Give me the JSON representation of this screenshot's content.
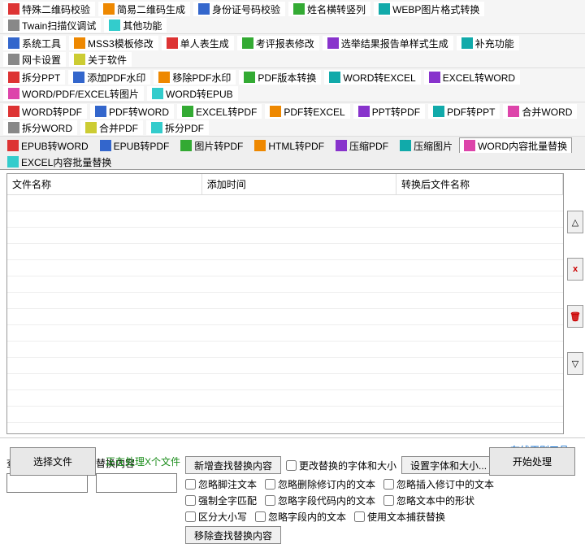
{
  "toolbar_rows": [
    [
      {
        "label": "特殊二维码校验",
        "ic": "ic-red",
        "name": "special-qr-verify"
      },
      {
        "label": "简易二维码生成",
        "ic": "ic-orange",
        "name": "simple-qr-gen"
      },
      {
        "label": "身份证号码校验",
        "ic": "ic-blue",
        "name": "id-verify"
      },
      {
        "label": "姓名横转竖列",
        "ic": "ic-green",
        "name": "name-rotate"
      },
      {
        "label": "WEBP图片格式转换",
        "ic": "ic-teal",
        "name": "webp-convert"
      },
      {
        "label": "Twain扫描仪调试",
        "ic": "ic-gray",
        "name": "twain-scan"
      },
      {
        "label": "其他功能",
        "ic": "ic-cyan",
        "name": "other-tools"
      }
    ],
    [
      {
        "label": "系统工具",
        "ic": "ic-blue",
        "name": "system-tools"
      },
      {
        "label": "MSS3模板修改",
        "ic": "ic-orange",
        "name": "mss3-template"
      },
      {
        "label": "单人表生成",
        "ic": "ic-red",
        "name": "single-form"
      },
      {
        "label": "考评报表修改",
        "ic": "ic-green",
        "name": "eval-report"
      },
      {
        "label": "选举结果报告单样式生成",
        "ic": "ic-purple",
        "name": "election-report"
      },
      {
        "label": "补充功能",
        "ic": "ic-teal",
        "name": "extra-func"
      },
      {
        "label": "网卡设置",
        "ic": "ic-gray",
        "name": "network-card"
      },
      {
        "label": "关于软件",
        "ic": "ic-yellow",
        "name": "about"
      }
    ],
    [
      {
        "label": "拆分PPT",
        "ic": "ic-red",
        "name": "split-ppt"
      },
      {
        "label": "添加PDF水印",
        "ic": "ic-blue",
        "name": "add-watermark"
      },
      {
        "label": "移除PDF水印",
        "ic": "ic-orange",
        "name": "remove-watermark"
      },
      {
        "label": "PDF版本转换",
        "ic": "ic-green",
        "name": "pdf-version"
      },
      {
        "label": "WORD转EXCEL",
        "ic": "ic-teal",
        "name": "word-to-excel"
      },
      {
        "label": "EXCEL转WORD",
        "ic": "ic-purple",
        "name": "excel-to-word"
      },
      {
        "label": "WORD/PDF/EXCEL转图片",
        "ic": "ic-pink",
        "name": "doc-to-image"
      },
      {
        "label": "WORD转EPUB",
        "ic": "ic-cyan",
        "name": "word-to-epub"
      }
    ],
    [
      {
        "label": "WORD转PDF",
        "ic": "ic-red",
        "name": "word-to-pdf"
      },
      {
        "label": "PDF转WORD",
        "ic": "ic-blue",
        "name": "pdf-to-word"
      },
      {
        "label": "EXCEL转PDF",
        "ic": "ic-green",
        "name": "excel-to-pdf"
      },
      {
        "label": "PDF转EXCEL",
        "ic": "ic-orange",
        "name": "pdf-to-excel"
      },
      {
        "label": "PPT转PDF",
        "ic": "ic-purple",
        "name": "ppt-to-pdf"
      },
      {
        "label": "PDF转PPT",
        "ic": "ic-teal",
        "name": "pdf-to-ppt"
      },
      {
        "label": "合并WORD",
        "ic": "ic-pink",
        "name": "merge-word"
      },
      {
        "label": "拆分WORD",
        "ic": "ic-gray",
        "name": "split-word"
      },
      {
        "label": "合并PDF",
        "ic": "ic-yellow",
        "name": "merge-pdf"
      },
      {
        "label": "拆分PDF",
        "ic": "ic-cyan",
        "name": "split-pdf"
      }
    ]
  ],
  "tabs": [
    {
      "label": "EPUB转WORD",
      "ic": "ic-red",
      "active": false
    },
    {
      "label": "EPUB转PDF",
      "ic": "ic-blue",
      "active": false
    },
    {
      "label": "图片转PDF",
      "ic": "ic-green",
      "active": false
    },
    {
      "label": "HTML转PDF",
      "ic": "ic-orange",
      "active": false
    },
    {
      "label": "压缩PDF",
      "ic": "ic-purple",
      "active": false
    },
    {
      "label": "压缩图片",
      "ic": "ic-teal",
      "active": false
    },
    {
      "label": "WORD内容批量替换",
      "ic": "ic-pink",
      "active": true
    },
    {
      "label": "EXCEL内容批量替换",
      "ic": "ic-cyan",
      "active": false
    }
  ],
  "table": {
    "columns": [
      "文件名称",
      "添加时间",
      "转换后文件名称"
    ]
  },
  "side_buttons": {
    "up": "△",
    "delete": "x",
    "remove": "🗑",
    "down": "▽"
  },
  "controls": {
    "search_label": "查找内容",
    "replace_label": "替换内容",
    "search_value": "",
    "replace_value": "",
    "add_rule_btn": "新增查找替换内容",
    "change_font_check": "更改替换的字体和大小",
    "set_font_btn": "设置字体和大小...",
    "remove_rule_btn": "移除查找替换内容",
    "checks_row1": [
      "忽略脚注文本",
      "忽略删除修订内的文本",
      "忽略插入修订中的文本"
    ],
    "checks_row2": [
      "强制全字匹配",
      "忽略字段代码内的文本",
      "忽略文本中的形状"
    ],
    "checks_row3": [
      "区分大小写",
      "忽略字段内的文本",
      "使用文本捕获替换"
    ],
    "online_tool_link": "在线正则工具"
  },
  "bottom": {
    "select_file_btn": "选择文件",
    "status_text": "正在处理X个文件",
    "start_btn": "开始处理"
  }
}
